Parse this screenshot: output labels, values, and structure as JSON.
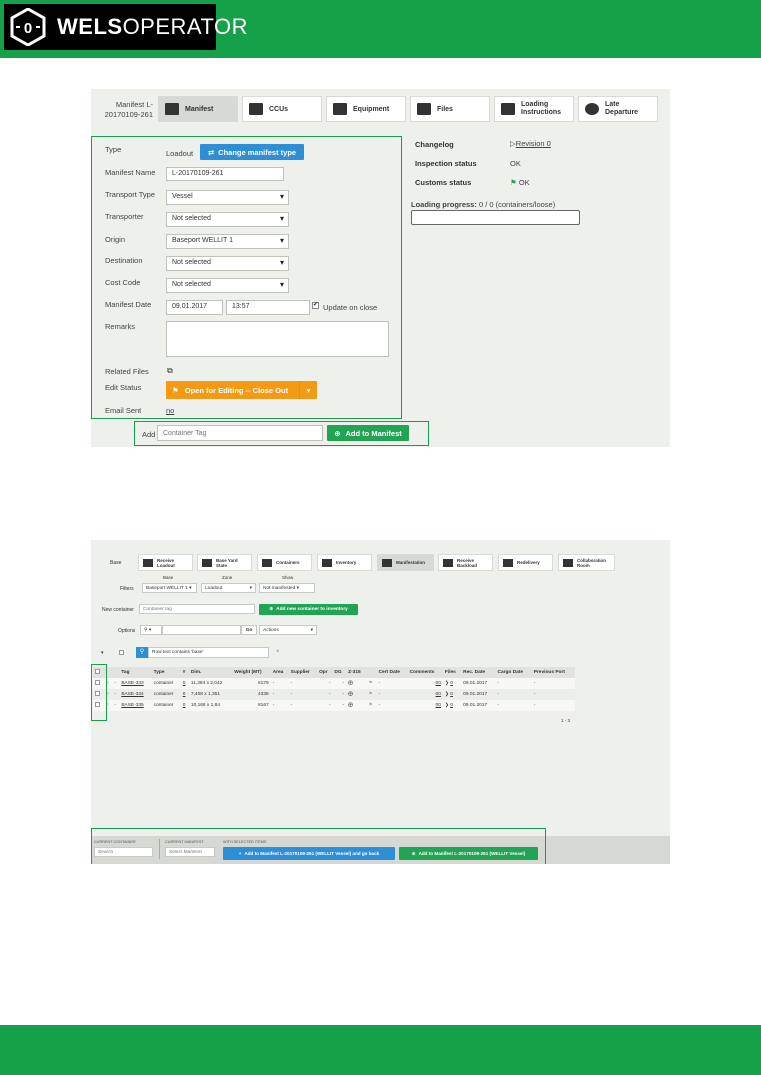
{
  "header": {
    "brand_bold": "WELS",
    "brand_light": "OPERATOR"
  },
  "manifest_view": {
    "manifest_label_line1": "Manifest L-",
    "manifest_label_line2": "20170109-261",
    "tabs": [
      {
        "label": "Manifest",
        "icon": "manifest-icon"
      },
      {
        "label": "CCUs",
        "icon": "ccus-icon"
      },
      {
        "label": "Equipment",
        "icon": "equipment-icon"
      },
      {
        "label": "Files",
        "icon": "files-icon"
      },
      {
        "label": "Loading Instructions",
        "icon": "loading-instructions-icon"
      },
      {
        "label": "Late Departure",
        "icon": "clock-icon"
      }
    ],
    "form": {
      "type_label": "Type",
      "type_value": "Loadout",
      "change_type_button": "Change manifest type",
      "name_label": "Manifest Name",
      "name_value": "L-20170109-261",
      "transport_type_label": "Transport Type",
      "transport_type_value": "Vessel",
      "transporter_label": "Transporter",
      "transporter_value": "Not selected",
      "origin_label": "Origin",
      "origin_value": "Baseport WELLIT 1",
      "destination_label": "Destination",
      "destination_value": "Not selected",
      "cost_code_label": "Cost Code",
      "cost_code_value": "Not selected",
      "date_label": "Manifest Date",
      "date_value": "09.01.2017",
      "time_value": "13:57",
      "update_on_close_label": "Update on close",
      "remarks_label": "Remarks",
      "related_files_label": "Related Files",
      "edit_status_label": "Edit Status",
      "edit_status_button": "Open for Editing -- Close Out",
      "email_sent_label": "Email Sent",
      "email_sent_value": "no"
    },
    "info": {
      "changelog_label": "Changelog",
      "changelog_value": "Revision 0",
      "inspection_label": "Inspection status",
      "inspection_value": "OK",
      "customs_label": "Customs status",
      "customs_value": "OK",
      "loading_progress_label": "Loading progress:",
      "loading_progress_value": "0 / 0 (containers/loose)",
      "loading_progress_fraction": 0
    },
    "add_row": {
      "label": "Add",
      "placeholder": "Container Tag",
      "button": "Add to Manifest"
    }
  },
  "base_view": {
    "base_label": "Base",
    "tabs": [
      {
        "label1": "Receive",
        "label2": "Loadout",
        "icon": "receive-loadout-icon"
      },
      {
        "label1": "Base Yard",
        "label2": "State",
        "icon": "base-yard-icon"
      },
      {
        "label1": "Containers",
        "label2": "",
        "icon": "containers-icon"
      },
      {
        "label1": "Inventory",
        "label2": "",
        "icon": "inventory-icon"
      },
      {
        "label1": "Manifestation",
        "label2": "",
        "icon": "manifestation-icon"
      },
      {
        "label1": "Receive",
        "label2": "Backload",
        "icon": "receive-backload-icon"
      },
      {
        "label1": "Redelivery",
        "label2": "",
        "icon": "redelivery-icon"
      },
      {
        "label1": "Collaboration",
        "label2": "Room",
        "icon": "collaboration-icon"
      }
    ],
    "filters": {
      "label": "Filters",
      "base_head": "Base",
      "base_value": "Baseport WELLIT 1",
      "zone_head": "Zone",
      "zone_value": "Loadout",
      "show_head": "Show",
      "show_value": "Not manifested"
    },
    "new_container": {
      "label": "New container",
      "placeholder": "Container tag",
      "button": "Add new container to inventory"
    },
    "options": {
      "label": "Options",
      "go_button": "Go",
      "actions_value": "Actions"
    },
    "search_chip": "Row text contains 'base'",
    "search_clear": "×",
    "table": {
      "headers": [
        "Tag",
        "Type",
        "#",
        "Dim.",
        "Weight (MT)",
        "Area",
        "Supplier",
        "Opr",
        "DG",
        "Z-315",
        "Cert Date",
        "Comments",
        "Files",
        "Rec. Date",
        "Cargo Date",
        "Previous Port"
      ],
      "rows": [
        {
          "tag": "BASE-333",
          "type": "container",
          "num": "0",
          "dim": "11,384 x 2,042",
          "weight": "6179",
          "area": "-",
          "supplier": "-",
          "opr": "-",
          "dg": "-",
          "cert": "-",
          "comments": "00",
          "files": "0",
          "rec": "09.01.2017",
          "cargo": "-",
          "prev": "-"
        },
        {
          "tag": "BASE-334",
          "type": "container",
          "num": "0",
          "dim": "7,408 x 1,351",
          "weight": "4338",
          "area": "-",
          "supplier": "-",
          "opr": "-",
          "dg": "-",
          "cert": "-",
          "comments": "00",
          "files": "0",
          "rec": "09.01.2017",
          "cargo": "-",
          "prev": "-"
        },
        {
          "tag": "BASE-335",
          "type": "container",
          "num": "0",
          "dim": "10,168 x 1,84",
          "weight": "8167",
          "area": "-",
          "supplier": "-",
          "opr": "-",
          "dg": "-",
          "cert": "-",
          "comments": "00",
          "files": "0",
          "rec": "09.01.2017",
          "cargo": "-",
          "prev": "-"
        }
      ],
      "pagination": "1 - 3"
    },
    "footer": {
      "current_container_head": "CURRENT CONTAINER",
      "current_container_placeholder": "Search",
      "current_manifest_head": "CURRENT MANIFEST",
      "current_manifest_placeholder": "Select Manifest",
      "selected_head": "WITH SELECTED ITEMS",
      "add_go_back_button": "Add to Manifest L-20170109-261 (WELLIT Vessel) and go back",
      "add_button": "Add to Manifest L-20170109-261 (WELLIT Vessel)"
    }
  }
}
